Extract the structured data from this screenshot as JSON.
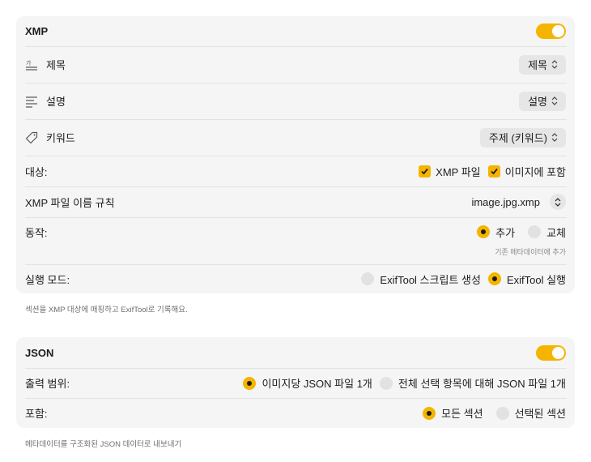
{
  "xmp": {
    "title": "XMP",
    "enabled": true,
    "title_field": {
      "label": "제목",
      "value": "제목"
    },
    "desc_field": {
      "label": "설명",
      "value": "설명"
    },
    "keyword_field": {
      "label": "키워드",
      "value": "주제 (키워드)"
    },
    "target": {
      "label": "대상:",
      "opt1": "XMP 파일",
      "opt1_checked": true,
      "opt2": "이미지에 포함",
      "opt2_checked": true
    },
    "naming": {
      "label": "XMP 파일 이름 규칙",
      "value": "image.jpg.xmp"
    },
    "action": {
      "label": "동작:",
      "opt_add": "추가",
      "opt_replace": "교체",
      "selected": "추가",
      "hint": "기존 메타데이터에 추가"
    },
    "run_mode": {
      "label": "실행 모드:",
      "opt_script": "ExifTool 스크립트 생성",
      "opt_run": "ExifTool 실행",
      "selected": "ExifTool 실행"
    },
    "footnote": "섹션을 XMP 대상에 매핑하고 ExifTool로 기록해요."
  },
  "json": {
    "title": "JSON",
    "enabled": true,
    "scope": {
      "label": "출력 범위:",
      "opt_per_image": "이미지당 JSON 파일 1개",
      "opt_all": "전체 선택 항목에 대해 JSON 파일 1개",
      "selected": "이미지당 JSON 파일 1개"
    },
    "include": {
      "label": "포함:",
      "opt_all": "모든 섹션",
      "opt_selected": "선택된 섹션",
      "selected": "모든 섹션"
    },
    "footnote": "메타데이터를 구조화된 JSON 데이터로 내보내기"
  },
  "colors": {
    "accent": "#f5b400",
    "panel": "#f5f5f5",
    "popup": "#e6e6e6"
  },
  "icons": [
    "title-text-icon",
    "description-lines-icon",
    "tag-icon",
    "checkmark-icon",
    "chevron-updown-icon"
  ]
}
